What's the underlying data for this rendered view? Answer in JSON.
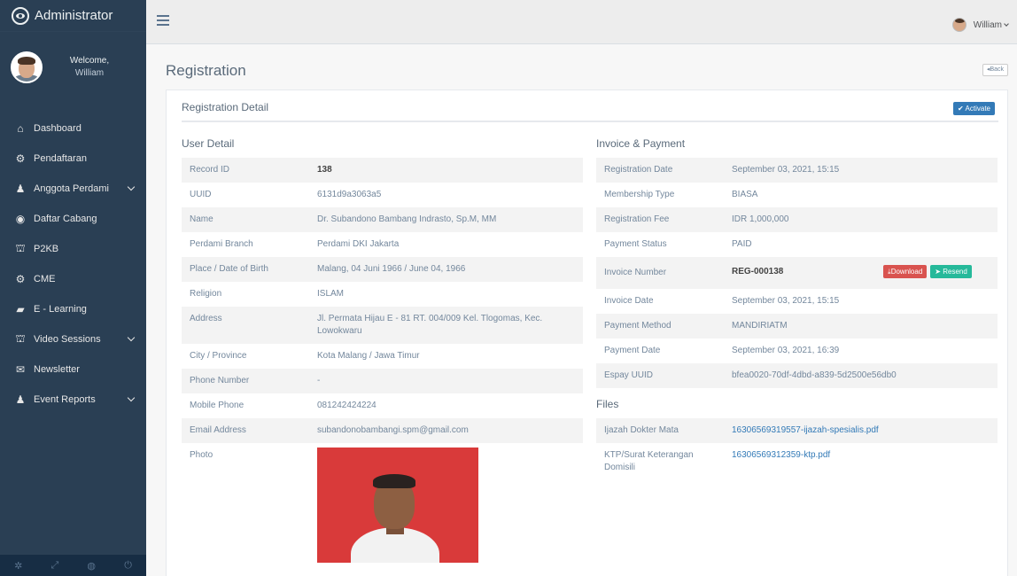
{
  "brand": {
    "title": "Administrator"
  },
  "profile": {
    "welcome": "Welcome,",
    "name": "William"
  },
  "sidebar": {
    "items": [
      {
        "label": "Dashboard",
        "icon": "home-icon",
        "glyph": "⌂",
        "has_children": false
      },
      {
        "label": "Pendaftaran",
        "icon": "gears-icon",
        "glyph": "⚙",
        "has_children": false
      },
      {
        "label": "Anggota Perdami",
        "icon": "user-icon",
        "glyph": "♟",
        "has_children": true
      },
      {
        "label": "Daftar Cabang",
        "icon": "globe-icon",
        "glyph": "◉",
        "has_children": false
      },
      {
        "label": "P2KB",
        "icon": "institution-icon",
        "glyph": "⛫",
        "has_children": false
      },
      {
        "label": "CME",
        "icon": "gears-icon",
        "glyph": "⚙",
        "has_children": false
      },
      {
        "label": "E - Learning",
        "icon": "book-icon",
        "glyph": "▰",
        "has_children": false
      },
      {
        "label": "Video Sessions",
        "icon": "institution-icon",
        "glyph": "⛫",
        "has_children": true
      },
      {
        "label": "Newsletter",
        "icon": "envelope-icon",
        "glyph": "✉",
        "has_children": false
      },
      {
        "label": "Event Reports",
        "icon": "user-icon",
        "glyph": "♟",
        "has_children": true
      }
    ],
    "footer_icons": [
      "settings-icon",
      "fullscreen-icon",
      "lock-icon",
      "power-icon"
    ]
  },
  "topbar": {
    "user_name": "William"
  },
  "page": {
    "title": "Registration",
    "back_label": "Back"
  },
  "panel": {
    "title": "Registration Detail",
    "activate_label": "Activate"
  },
  "user_detail": {
    "title": "User Detail",
    "rows": [
      {
        "label": "Record ID",
        "value": "138"
      },
      {
        "label": "UUID",
        "value": "6131d9a3063a5"
      },
      {
        "label": "Name",
        "value": "Dr. Subandono Bambang Indrasto, Sp.M, MM"
      },
      {
        "label": "Perdami Branch",
        "value": "Perdami DKI Jakarta"
      },
      {
        "label": "Place / Date of Birth",
        "value": "Malang, 04 Juni 1966 / June 04, 1966"
      },
      {
        "label": "Religion",
        "value": "ISLAM"
      },
      {
        "label": "Address",
        "value": "Jl. Permata Hijau E - 81 RT. 004/009 Kel. Tlogomas, Kec. Lowokwaru"
      },
      {
        "label": "City / Province",
        "value": "Kota Malang / Jawa Timur"
      },
      {
        "label": "Phone Number",
        "value": "-"
      },
      {
        "label": "Mobile Phone",
        "value": "081242424224"
      },
      {
        "label": "Email Address",
        "value": "subandonobambangi.spm@gmail.com"
      }
    ],
    "photo_label": "Photo"
  },
  "invoice": {
    "title": "Invoice & Payment",
    "rows": [
      {
        "label": "Registration Date",
        "value": "September 03, 2021, 15:15"
      },
      {
        "label": "Membership Type",
        "value": "BIASA"
      },
      {
        "label": "Registration Fee",
        "value": "IDR 1,000,000"
      },
      {
        "label": "Payment Status",
        "value": "PAID"
      },
      {
        "label": "Invoice Number",
        "value": "REG-000138"
      },
      {
        "label": "Invoice Date",
        "value": "September 03, 2021, 15:15"
      },
      {
        "label": "Payment Method",
        "value": "MANDIRIATM"
      },
      {
        "label": "Payment Date",
        "value": "September 03, 2021, 16:39"
      },
      {
        "label": "Espay UUID",
        "value": "bfea0020-70df-4dbd-a839-5d2500e56db0"
      }
    ],
    "download_label": "Download",
    "resend_label": "Resend"
  },
  "files": {
    "title": "Files",
    "rows": [
      {
        "label": "Ijazah Dokter Mata",
        "value": "16306569319557-ijazah-spesialis.pdf"
      },
      {
        "label": "KTP/Surat Keterangan Domisili",
        "value": "16306569312359-ktp.pdf"
      }
    ]
  },
  "colors": {
    "sidebar_bg": "#2a3f54",
    "primary": "#337ab7",
    "danger": "#d9534f",
    "success": "#26b99a"
  }
}
